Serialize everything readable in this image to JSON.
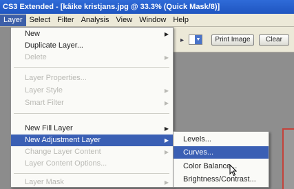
{
  "title_bar": {
    "text": "CS3 Extended - [kâike kristjans.jpg @ 33.3% (Quick Mask/8)]"
  },
  "menubar": {
    "items": [
      "Layer",
      "Select",
      "Filter",
      "Analysis",
      "View",
      "Window",
      "Help"
    ],
    "active_index": 0
  },
  "options_bar": {
    "print_size_label": "Print Image",
    "clear_label": "Clear"
  },
  "layer_menu": {
    "new": "New",
    "duplicate_layer": "Duplicate Layer...",
    "delete": "Delete",
    "layer_properties": "Layer Properties...",
    "layer_style": "Layer Style",
    "smart_filter": "Smart Filter",
    "new_fill_layer": "New Fill Layer",
    "new_adjustment_layer": "New Adjustment Layer",
    "change_layer_content": "Change Layer Content",
    "layer_content_options": "Layer Content Options...",
    "layer_mask": "Layer Mask"
  },
  "adjustment_submenu": {
    "items": [
      "Levels...",
      "Curves...",
      "Color Balance...",
      "Brightness/Contrast..."
    ],
    "highlight_index": 1
  },
  "colors": {
    "title_bar": "#1f55c0",
    "menu_highlight": "#3a5fb4",
    "disabled_text": "#b9b9b4",
    "document_edge": "#c4423a"
  }
}
